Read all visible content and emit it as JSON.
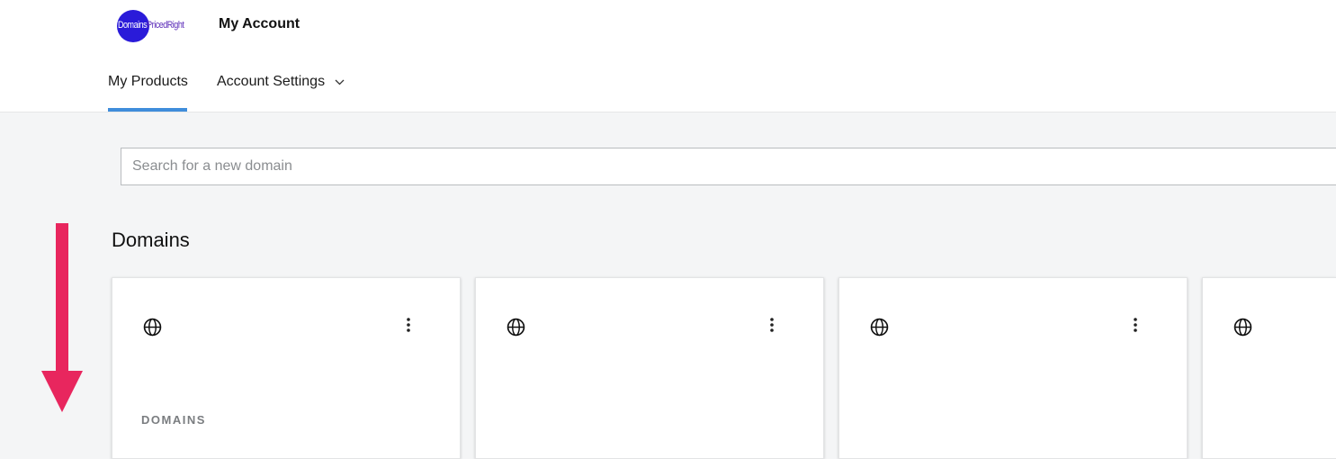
{
  "header": {
    "logo": {
      "word1": "Domains",
      "word2": "PricedRight",
      "circle_color": "#2a1bd9"
    },
    "title": "My Account"
  },
  "tabs": [
    {
      "label": "My Products",
      "active": true
    },
    {
      "label": "Account Settings",
      "active": false,
      "icon": "chevron-down-icon"
    }
  ],
  "accent_color": "#3f8ddb",
  "search": {
    "placeholder": "Search for a new domain",
    "value": ""
  },
  "domains": {
    "title": "Domains",
    "cards": [
      {
        "icon": "globe-icon",
        "menu_icon": "more-vert-icon",
        "caption": "DOMAINS"
      },
      {
        "icon": "globe-icon",
        "menu_icon": "more-vert-icon",
        "caption": ""
      },
      {
        "icon": "globe-icon",
        "menu_icon": "more-vert-icon",
        "caption": ""
      },
      {
        "icon": "globe-icon",
        "menu_icon": "",
        "caption": ""
      }
    ]
  },
  "annotation": {
    "icon": "arrow-down-icon",
    "color": "#e8265e"
  }
}
